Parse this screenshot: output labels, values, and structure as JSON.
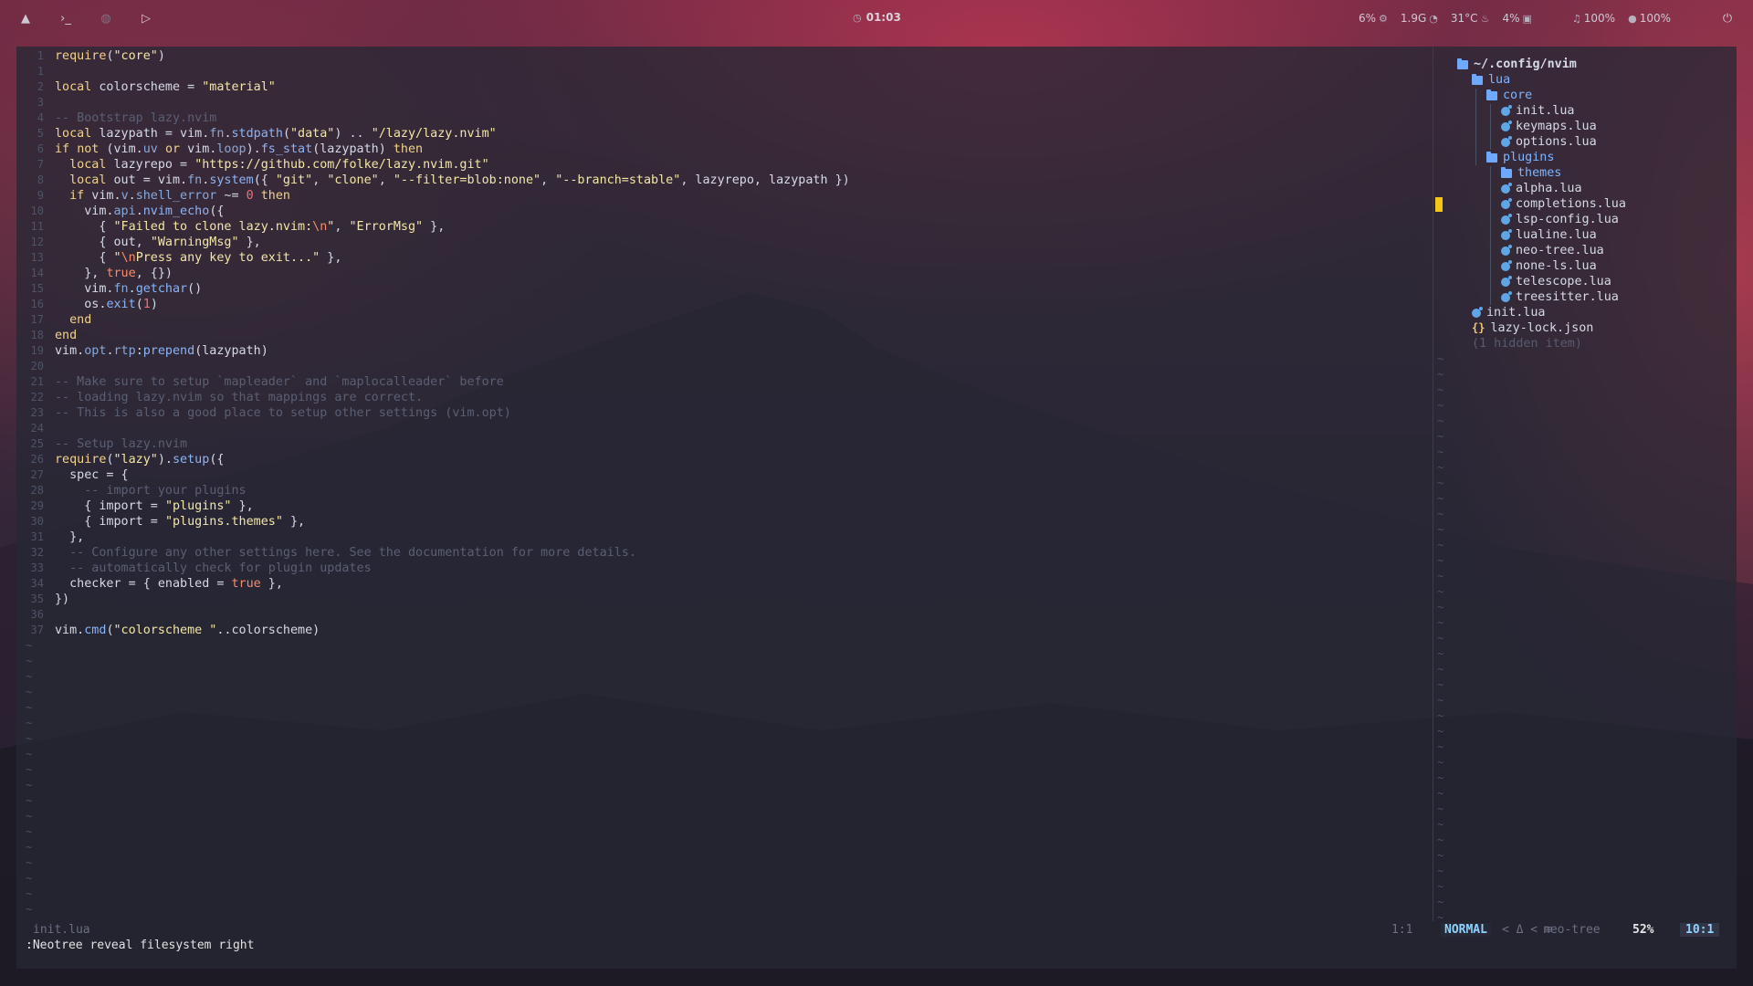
{
  "topbar": {
    "left_icons": [
      "arch-icon",
      "terminal-icon",
      "shield-icon",
      "play-icon"
    ],
    "clock": "01:03",
    "stats": {
      "cpu": "6%",
      "mem": "1.9G",
      "temp": "31°C",
      "disk": "4%",
      "volume": "100%",
      "mic": "100%"
    }
  },
  "editor": {
    "lines": [
      {
        "n": "1",
        "code": "require(\"core\")"
      },
      {
        "n": "1",
        "code": ""
      },
      {
        "n": "2",
        "code": "local colorscheme = \"material\""
      },
      {
        "n": "3",
        "code": ""
      },
      {
        "n": "4",
        "code": "-- Bootstrap lazy.nvim"
      },
      {
        "n": "5",
        "code": "local lazypath = vim.fn.stdpath(\"data\") .. \"/lazy/lazy.nvim\""
      },
      {
        "n": "6",
        "code": "if not (vim.uv or vim.loop).fs_stat(lazypath) then"
      },
      {
        "n": "7",
        "code": "  local lazyrepo = \"https://github.com/folke/lazy.nvim.git\""
      },
      {
        "n": "8",
        "code": "  local out = vim.fn.system({ \"git\", \"clone\", \"--filter=blob:none\", \"--branch=stable\", lazyrepo, lazypath })"
      },
      {
        "n": "9",
        "code": "  if vim.v.shell_error ~= 0 then"
      },
      {
        "n": "10",
        "code": "    vim.api.nvim_echo({"
      },
      {
        "n": "11",
        "code": "      { \"Failed to clone lazy.nvim:\\n\", \"ErrorMsg\" },"
      },
      {
        "n": "12",
        "code": "      { out, \"WarningMsg\" },"
      },
      {
        "n": "13",
        "code": "      { \"\\nPress any key to exit...\" },"
      },
      {
        "n": "14",
        "code": "    }, true, {})"
      },
      {
        "n": "15",
        "code": "    vim.fn.getchar()"
      },
      {
        "n": "16",
        "code": "    os.exit(1)"
      },
      {
        "n": "17",
        "code": "  end"
      },
      {
        "n": "18",
        "code": "end"
      },
      {
        "n": "19",
        "code": "vim.opt.rtp:prepend(lazypath)"
      },
      {
        "n": "20",
        "code": ""
      },
      {
        "n": "21",
        "code": "-- Make sure to setup `mapleader` and `maplocalleader` before"
      },
      {
        "n": "22",
        "code": "-- loading lazy.nvim so that mappings are correct."
      },
      {
        "n": "23",
        "code": "-- This is also a good place to setup other settings (vim.opt)"
      },
      {
        "n": "24",
        "code": ""
      },
      {
        "n": "25",
        "code": "-- Setup lazy.nvim"
      },
      {
        "n": "26",
        "code": "require(\"lazy\").setup({"
      },
      {
        "n": "27",
        "code": "  spec = {"
      },
      {
        "n": "28",
        "code": "    -- import your plugins"
      },
      {
        "n": "29",
        "code": "    { import = \"plugins\" },"
      },
      {
        "n": "30",
        "code": "    { import = \"plugins.themes\" },"
      },
      {
        "n": "31",
        "code": "  },"
      },
      {
        "n": "32",
        "code": "  -- Configure any other settings here. See the documentation for more details."
      },
      {
        "n": "33",
        "code": "  -- automatically check for plugin updates"
      },
      {
        "n": "34",
        "code": "  checker = { enabled = true },"
      },
      {
        "n": "35",
        "code": "})"
      },
      {
        "n": "36",
        "code": ""
      },
      {
        "n": "37",
        "code": "vim.cmd(\"colorscheme \"..colorscheme)"
      }
    ],
    "tilde": "~"
  },
  "tree": {
    "root": "~/.config/nvim",
    "lua": "lua",
    "core": "core",
    "core_files": [
      "init.lua",
      "keymaps.lua",
      "options.lua"
    ],
    "plugins": "plugins",
    "themes": "themes",
    "plugin_files": [
      "alpha.lua",
      "completions.lua",
      "lsp-config.lua",
      "lualine.lua",
      "neo-tree.lua",
      "none-ls.lua",
      "telescope.lua",
      "treesitter.lua"
    ],
    "init": "init.lua",
    "lock": "lazy-lock.json",
    "json_glyph": "{}",
    "hidden": "(1 hidden item)"
  },
  "status": {
    "filename": "init.lua",
    "cursor": "1:1",
    "mode": "NORMAL",
    "arrows": "<  Δ  <  ≡",
    "filetype": "neo-tree",
    "percent": "52%",
    "rowcol": "10:1"
  },
  "cmdline": ":Neotree reveal filesystem right"
}
